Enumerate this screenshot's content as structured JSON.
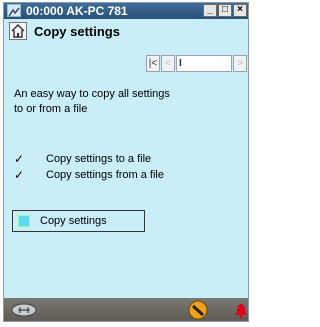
{
  "window": {
    "title": "00:000 AK-PC 781",
    "controls": {
      "minimize": "_",
      "maximize": "□",
      "close": "×"
    }
  },
  "header": {
    "title": "Copy settings"
  },
  "nav": {
    "first": "|<",
    "prev": "<",
    "current": "I",
    "next": ">"
  },
  "description": {
    "line1": "An easy way to copy all settings",
    "line2": "to or from a file"
  },
  "menu": {
    "items": [
      {
        "check": "✓",
        "label": "Copy settings to a file"
      },
      {
        "check": "✓",
        "label": "Copy settings from a file"
      }
    ]
  },
  "action": {
    "label": "Copy settings"
  },
  "colors": {
    "titlebar": "#27507a",
    "background": "#c9eef8",
    "swatch": "#5fd7f3",
    "alarm": "#e0001b"
  },
  "icons": {
    "app": "network-icon",
    "home": "home-icon",
    "bottom_left": "gripper-icon",
    "bottom_mid": "tool-icon",
    "bottom_right": "alarm-bell-icon"
  }
}
